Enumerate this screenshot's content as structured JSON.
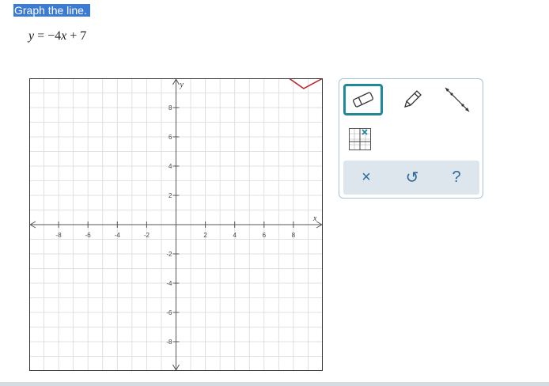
{
  "question": {
    "prompt": "Graph the line.",
    "equation": {
      "lhs": "y",
      "eq": " = −4",
      "var_x": "x",
      "rest": " + 7"
    }
  },
  "graph": {
    "x_axis_label": "x",
    "y_axis_label": "y",
    "x_range": [
      -10,
      10
    ],
    "y_range": [
      -10,
      10
    ],
    "grid_step": 1,
    "x_tick_labels": [
      "-8",
      "-6",
      "-4",
      "-2",
      "2",
      "4",
      "6",
      "8"
    ],
    "y_tick_labels": [
      "8",
      "6",
      "4",
      "2",
      "-2",
      "-4",
      "-6",
      "-8"
    ],
    "grid_color": "#d9d9d9",
    "axis_color": "#555555",
    "partial_shape_color": "#c0282d"
  },
  "toolbar": {
    "tools": [
      {
        "name": "eraser",
        "icon": "eraser-icon",
        "selected": true
      },
      {
        "name": "pencil",
        "icon": "pencil-icon",
        "selected": false
      },
      {
        "name": "line",
        "icon": "line-tool-icon",
        "selected": false
      },
      {
        "name": "graph-settings",
        "icon": "grid-settings-icon",
        "selected": false
      }
    ],
    "actions": [
      {
        "name": "clear",
        "label": "×",
        "icon": "close-icon"
      },
      {
        "name": "undo",
        "label": "↺",
        "icon": "undo-icon"
      },
      {
        "name": "help",
        "label": "?",
        "icon": "help-icon"
      }
    ],
    "accent_color": "#1f8a95"
  }
}
